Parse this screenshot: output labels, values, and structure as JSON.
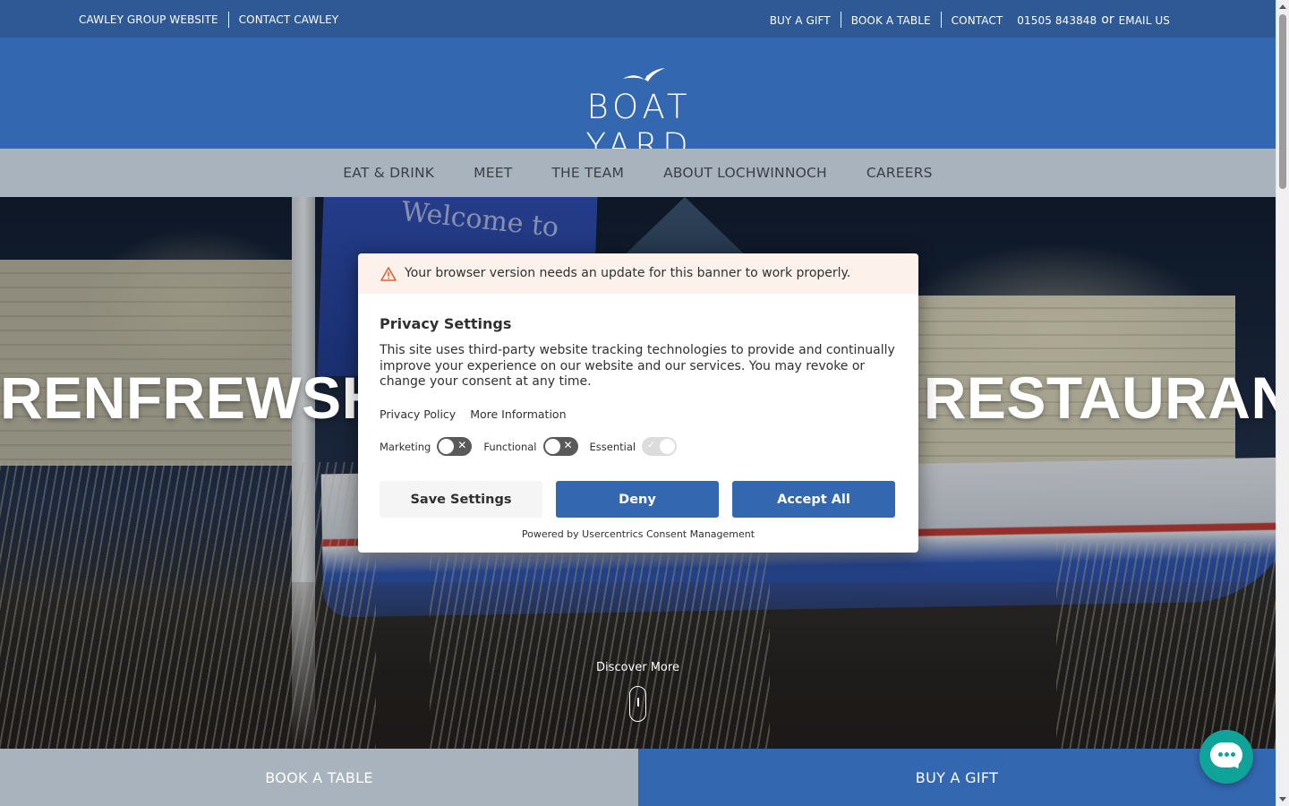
{
  "topbar": {
    "left_links": [
      "CAWLEY GROUP WEBSITE",
      "CONTACT CAWLEY"
    ],
    "right_links": [
      "BUY A GIFT",
      "BOOK A TABLE",
      "CONTACT"
    ],
    "phone": "01505 843848",
    "or_text": "or",
    "email": "EMAIL US"
  },
  "brand": {
    "name": "BOAT YARD",
    "bg_color": "#3367b0"
  },
  "nav": {
    "items": [
      "EAT & DRINK",
      "MEET",
      "THE TEAM",
      "ABOUT LOCHWINNOCH",
      "CAREERS"
    ]
  },
  "hero": {
    "flag_text": "Welcome to",
    "title": "RENFREWSHIRE'S WATERSIDE RESTAURANT",
    "discover": "Discover More"
  },
  "cta": {
    "book": "BOOK A TABLE",
    "gift": "BUY A GIFT"
  },
  "consent": {
    "warning": "Your browser version needs an update for this banner to work properly.",
    "title": "Privacy Settings",
    "body": "This site uses third-party website tracking technologies to provide and continually improve your experience on our website and our services. You may revoke or change your consent at any time.",
    "links": [
      "Privacy Policy",
      "More Information"
    ],
    "toggles": [
      {
        "label": "Marketing",
        "state": "off"
      },
      {
        "label": "Functional",
        "state": "off"
      },
      {
        "label": "Essential",
        "state": "on-locked"
      }
    ],
    "buttons": {
      "save": "Save Settings",
      "deny": "Deny",
      "accept": "Accept All"
    },
    "powered_by": "Powered by Usercentrics Consent Management"
  },
  "icons": {
    "chat": "chat-bubble-icon",
    "warning": "warning-triangle-icon",
    "scroll": "scroll-mouse-icon"
  }
}
